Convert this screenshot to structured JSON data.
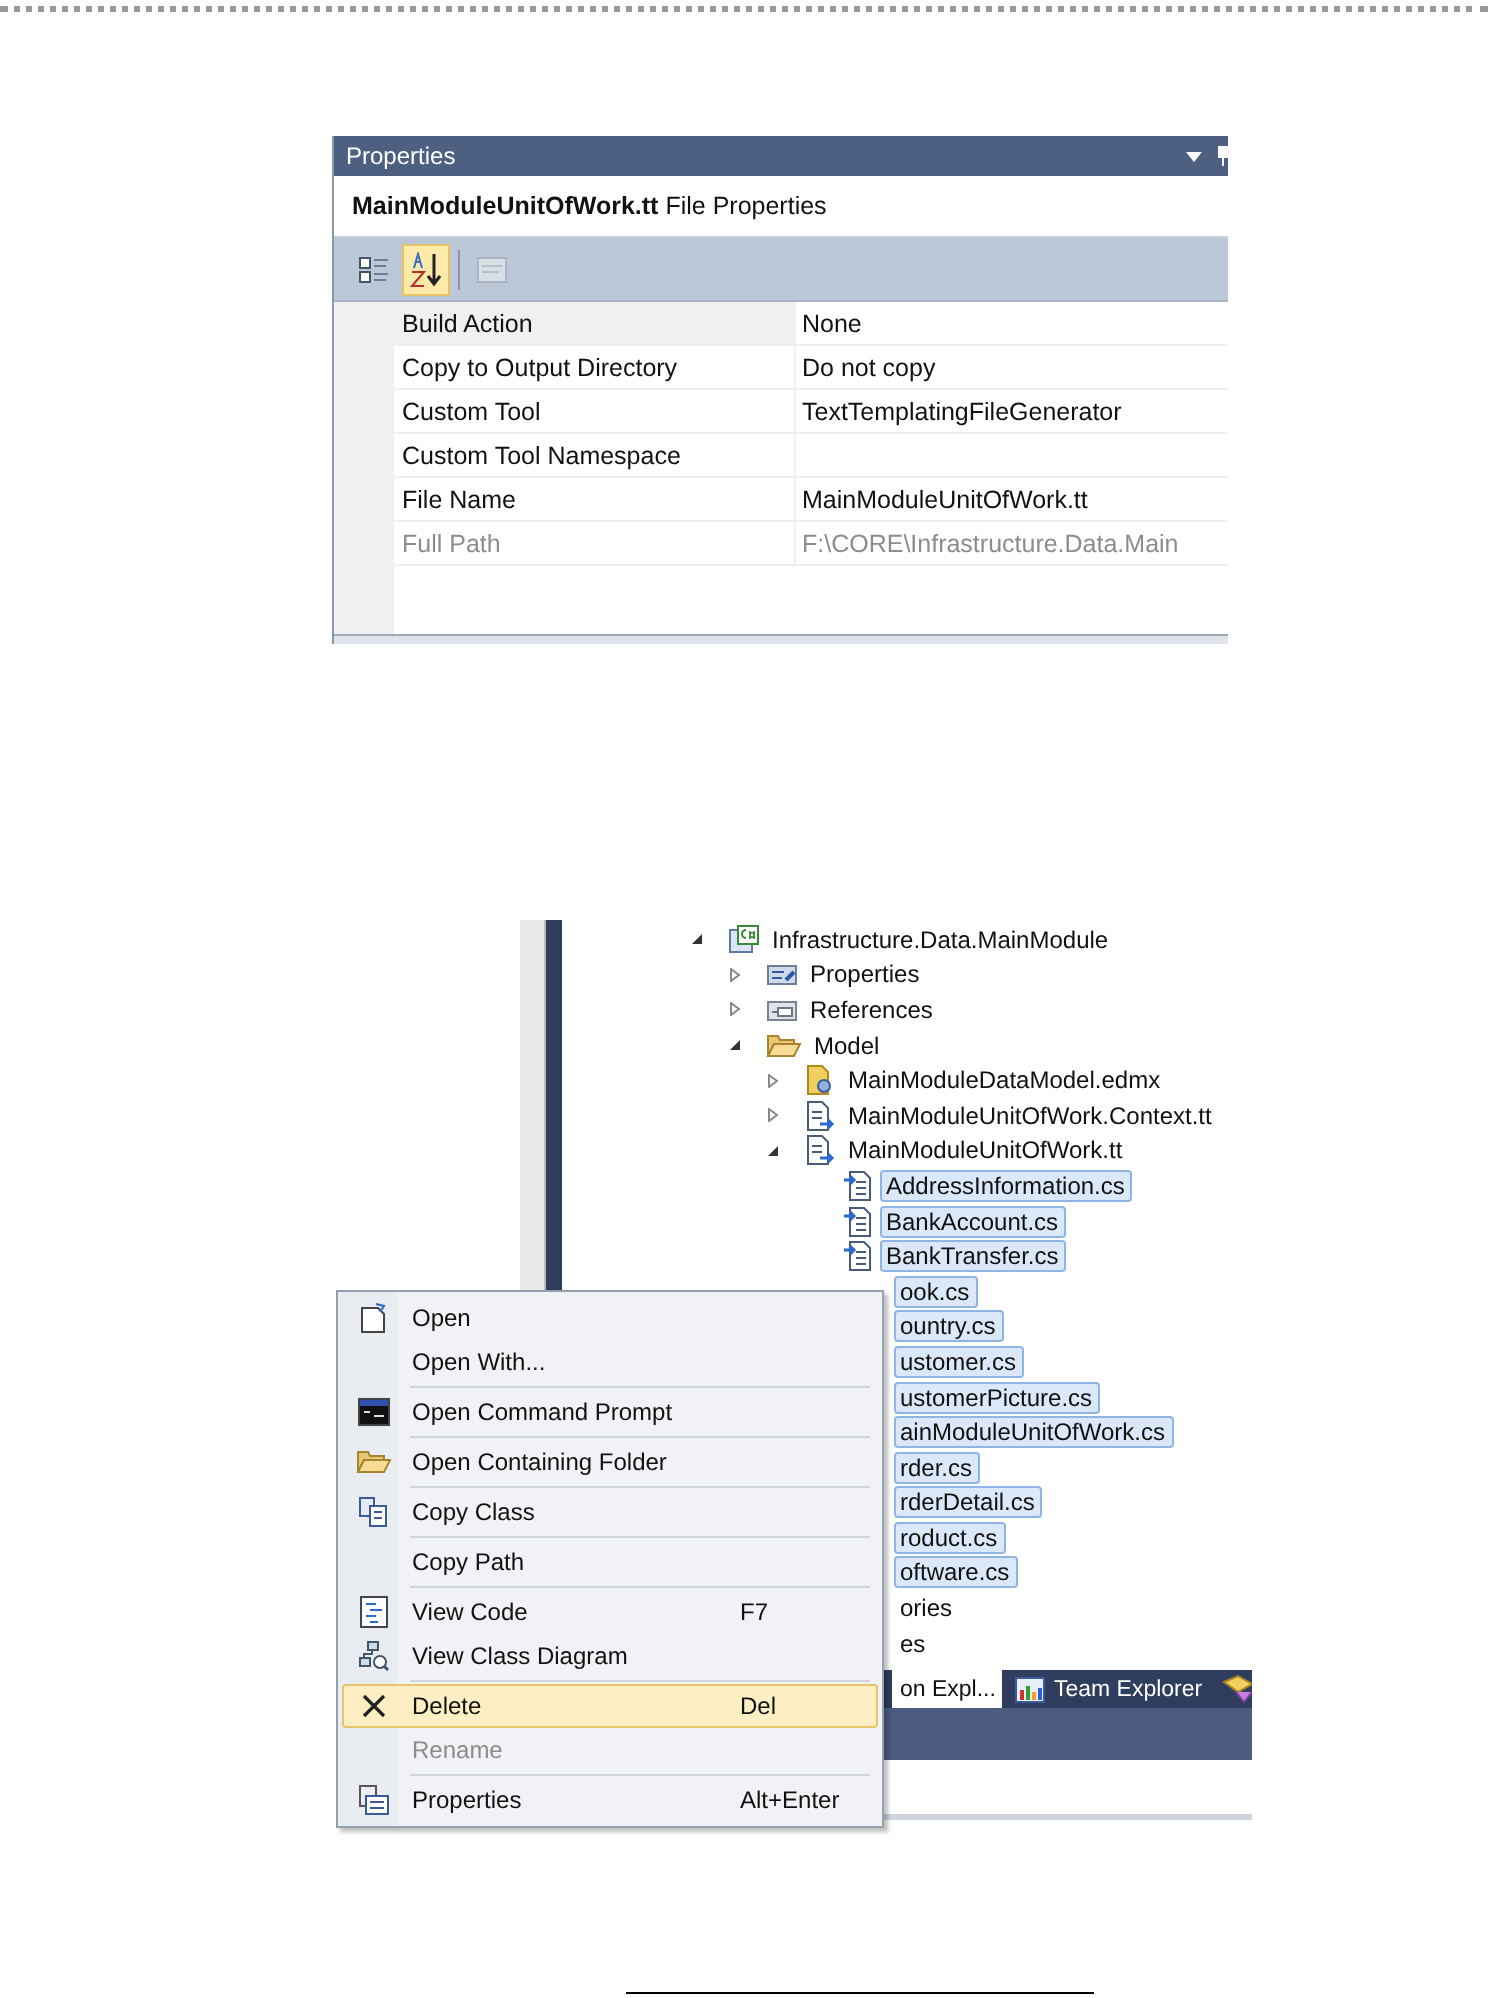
{
  "properties_panel": {
    "title": "Properties",
    "header": "**MainModuleUnitOfWork.tt** File Properties",
    "toolbar": [
      {
        "kind": "categorized",
        "selected": false,
        "disabled": false
      },
      {
        "kind": "alphabetical",
        "selected": true,
        "disabled": false
      },
      {
        "kind": "pages",
        "selected": false,
        "disabled": true
      }
    ],
    "rows": [
      {
        "name": "Build Action",
        "value": "None",
        "selected": true,
        "disabled": false
      },
      {
        "name": "Copy to Output Directory",
        "value": "Do not copy",
        "selected": false,
        "disabled": false
      },
      {
        "name": "Custom Tool",
        "value": "TextTemplatingFileGenerator",
        "selected": false,
        "disabled": false
      },
      {
        "name": "Custom Tool Namespace",
        "selected": false,
        "disabled": false
      },
      {
        "name": "File Name",
        "value": "MainModuleUnitOfWork.tt",
        "selected": false,
        "disabled": false
      },
      {
        "name": "Full Path",
        "value": "F:\\CORE\\Infrastructure.Data.Main",
        "selected": false,
        "disabled": true
      }
    ]
  },
  "solution_explorer": {
    "tree": [
      {
        "label": "Infrastructure.Data.MainModule",
        "kind": "project",
        "expanded": true,
        "selected": false,
        "children": [
          {
            "label": "Properties",
            "kind": "properties",
            "expanded": false,
            "selected": false
          },
          {
            "label": "References",
            "kind": "references",
            "expanded": false,
            "selected": false
          },
          {
            "label": "Model",
            "kind": "folder",
            "expanded": true,
            "selected": false,
            "children": [
              {
                "label": "MainModuleDataModel.edmx",
                "kind": "edmx",
                "expanded": false,
                "selected": false
              },
              {
                "label": "MainModuleUnitOfWork.Context.tt",
                "kind": "template",
                "expanded": false,
                "selected": false
              },
              {
                "label": "MainModuleUnitOfWork.tt",
                "kind": "template",
                "expanded": true,
                "selected": false,
                "children": [
                  {
                    "label": "AddressInformation.cs",
                    "kind": "file",
                    "selected": true
                  },
                  {
                    "label": "BankAccount.cs",
                    "kind": "file",
                    "selected": true
                  },
                  {
                    "label": "BankTransfer.cs",
                    "kind": "file",
                    "selected": true
                  },
                  {
                    "label": "ook.cs",
                    "kind": "covered",
                    "selected": true
                  },
                  {
                    "label": "ountry.cs",
                    "kind": "covered",
                    "selected": true
                  },
                  {
                    "label": "ustomer.cs",
                    "kind": "covered",
                    "selected": true
                  },
                  {
                    "label": "ustomerPicture.cs",
                    "kind": "covered",
                    "selected": true
                  },
                  {
                    "label": "ainModuleUnitOfWork.cs",
                    "kind": "covered",
                    "selected": true
                  },
                  {
                    "label": "rder.cs",
                    "kind": "covered",
                    "selected": true
                  },
                  {
                    "label": "rderDetail.cs",
                    "kind": "covered",
                    "selected": true
                  },
                  {
                    "label": "roduct.cs",
                    "kind": "covered",
                    "selected": true
                  },
                  {
                    "label": "oftware.cs",
                    "kind": "covered",
                    "selected": true
                  }
                ]
              }
            ]
          },
          {
            "label": "ories",
            "kind": "covered",
            "selected": false
          },
          {
            "label": "es",
            "kind": "covered",
            "selected": false
          }
        ]
      }
    ],
    "tabs": [
      {
        "label": "on Expl...",
        "kind": "plain",
        "selected": true
      },
      {
        "label": "Team Explorer",
        "kind": "team",
        "selected": false
      },
      {
        "kind": "class",
        "selected": false
      }
    ]
  },
  "context_menu": {
    "items": [
      {
        "kind": "open",
        "label": "Open",
        "selected": false,
        "disabled": false
      },
      {
        "kind": "plain",
        "label": "Open With...",
        "selected": false,
        "disabled": false
      },
      {
        "kind": "separator"
      },
      {
        "kind": "command",
        "label": "Open Command Prompt",
        "selected": false,
        "disabled": false
      },
      {
        "kind": "separator"
      },
      {
        "kind": "folder",
        "label": "Open Containing Folder",
        "selected": false,
        "disabled": false
      },
      {
        "kind": "separator"
      },
      {
        "kind": "copy",
        "label": "Copy Class",
        "selected": false,
        "disabled": false
      },
      {
        "kind": "separator"
      },
      {
        "kind": "plain",
        "label": "Copy Path",
        "selected": false,
        "disabled": false
      },
      {
        "kind": "separator"
      },
      {
        "kind": "code",
        "label": "View Code",
        "shortcut": "F7",
        "selected": false,
        "disabled": false
      },
      {
        "kind": "diagram",
        "label": "View Class Diagram",
        "selected": false,
        "disabled": false
      },
      {
        "kind": "separator"
      },
      {
        "kind": "delete",
        "label": "Delete",
        "shortcut": "Del",
        "selected": true,
        "disabled": false
      },
      {
        "kind": "plain",
        "label": "Rename",
        "selected": false,
        "disabled": true
      },
      {
        "kind": "separator"
      },
      {
        "kind": "properties",
        "label": "Properties",
        "shortcut": "Alt+Enter",
        "selected": false,
        "disabled": false
      }
    ]
  }
}
